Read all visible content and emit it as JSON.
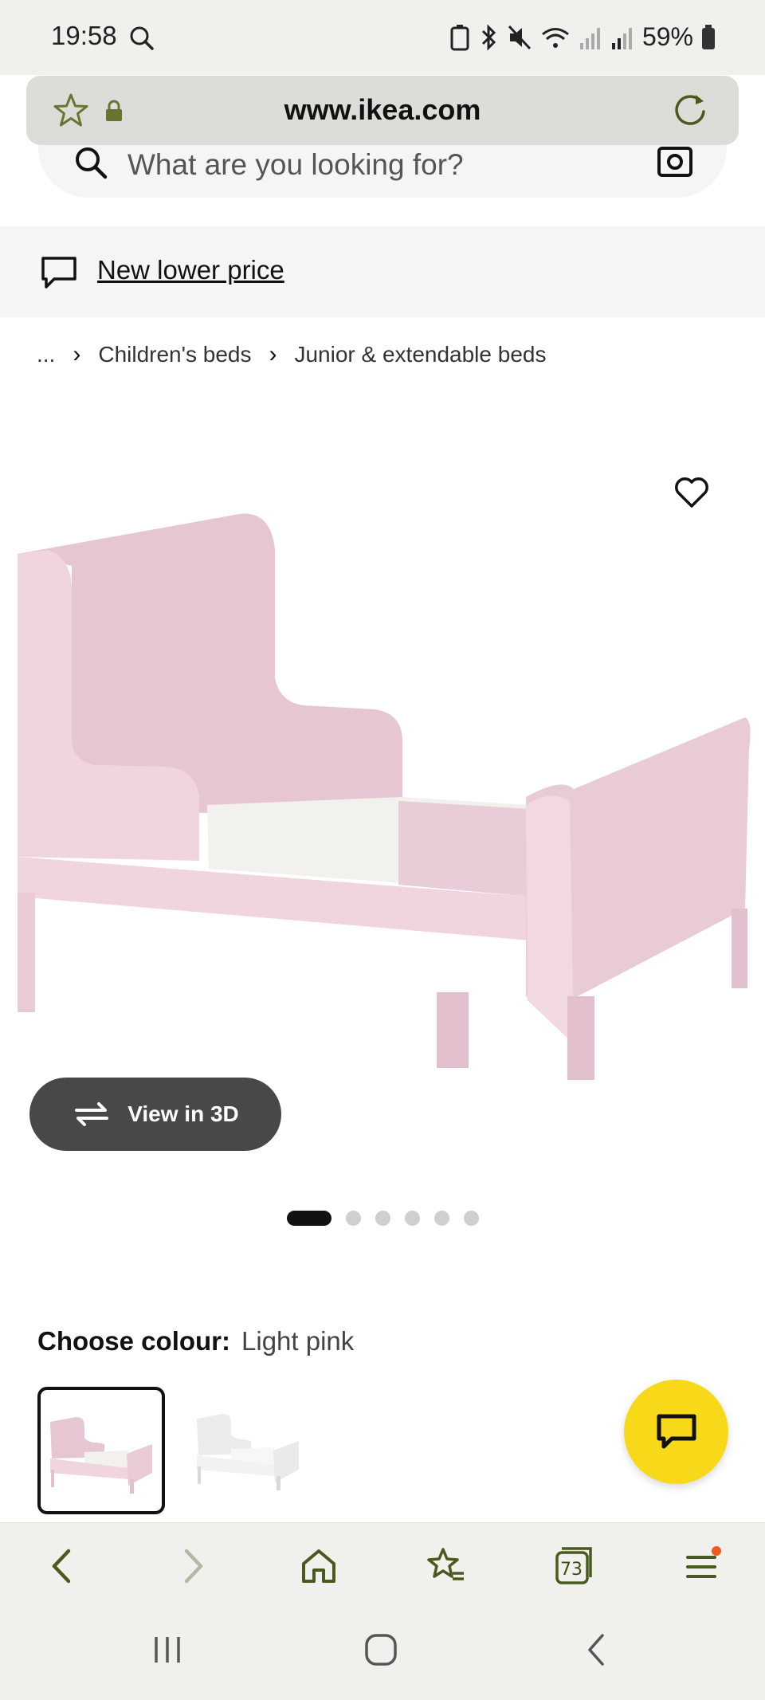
{
  "status_bar": {
    "time": "19:58",
    "battery": "59%"
  },
  "url_bar": {
    "url": "www.ikea.com"
  },
  "search": {
    "placeholder": "What are you looking for?"
  },
  "promo": {
    "text": "New lower price"
  },
  "breadcrumb": {
    "ellipsis": "...",
    "items": [
      "Children's beds",
      "Junior & extendable beds"
    ]
  },
  "product": {
    "view_3d_label": "View in 3D",
    "image_count": 6,
    "active_image": 0
  },
  "colour": {
    "label": "Choose colour:",
    "value": "Light pink",
    "options": [
      "Light pink",
      "White"
    ]
  },
  "toolbar": {
    "tabs_count": "73"
  },
  "colors": {
    "accent_yellow": "#f7d91a",
    "toolbar_icon": "#4a5a1e",
    "pink": "#e9cbd6"
  }
}
